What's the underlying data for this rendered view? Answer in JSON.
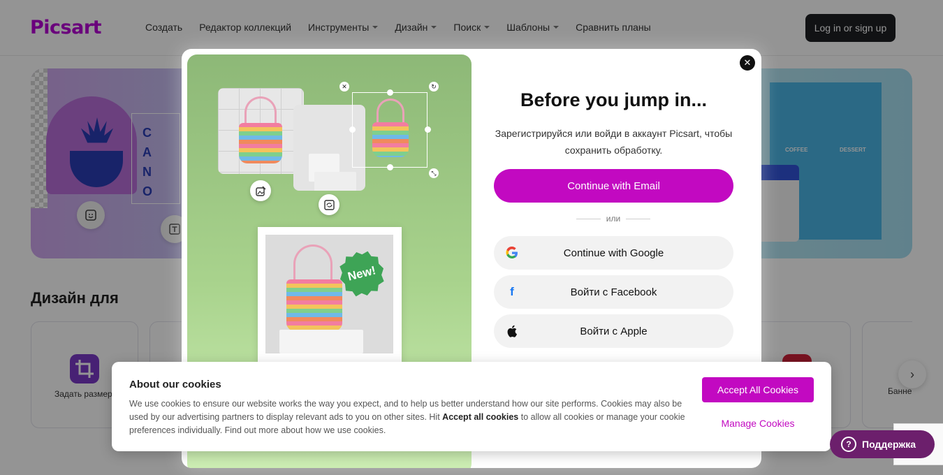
{
  "header": {
    "logo": "Picsart",
    "nav": [
      {
        "label": "Создать",
        "dropdown": false
      },
      {
        "label": "Редактор коллекций",
        "dropdown": false
      },
      {
        "label": "Инструменты",
        "dropdown": true
      },
      {
        "label": "Дизайн",
        "dropdown": true
      },
      {
        "label": "Поиск",
        "dropdown": true
      },
      {
        "label": "Шаблоны",
        "dropdown": true
      },
      {
        "label": "Сравнить планы",
        "dropdown": false
      }
    ],
    "login_label": "Log in or sign up"
  },
  "page": {
    "section_title": "Дизайн для",
    "categories": [
      {
        "label": "Задать размер"
      },
      {
        "label": "Банне"
      }
    ]
  },
  "modal": {
    "title": "Before you jump in...",
    "subtitle": "Зарегистрируйся или войди в аккаунт Picsart, чтобы сохранить обработку.",
    "email_button": "Continue with Email",
    "or_label": "или",
    "google_button": "Continue with Google",
    "facebook_button": "Войти с Facebook",
    "apple_button": "Войти с Apple",
    "badge_text": "New!"
  },
  "cookie": {
    "title": "About our cookies",
    "text_part1": "We use cookies to ensure our website works the way you expect, and to help us better understand how our site performs. Cookies may also be used by our advertising partners to display relevant ads to you on other sites. Hit ",
    "text_bold": "Accept all cookies",
    "text_part2": " to allow all cookies or manage your cookie preferences individually. Find out more about ",
    "text_link": "how we use cookies.",
    "accept_label": "Accept All Cookies",
    "manage_label": "Manage Cookies"
  },
  "support": {
    "label": "Поддержка"
  },
  "colors": {
    "brand": "#c209c1",
    "logo": "#b700d6",
    "support": "#6c1f6c",
    "login_bg": "#1e1f24"
  },
  "icons": {
    "close": "close-icon",
    "google": "google-icon",
    "facebook": "facebook-icon",
    "apple": "apple-icon",
    "support": "support-icon",
    "next": "chevron-right-icon"
  }
}
